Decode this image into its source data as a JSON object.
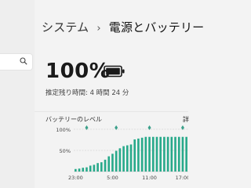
{
  "breadcrumb": {
    "parent": "システム",
    "separator": "›",
    "current": "電源とバッテリー"
  },
  "search": {
    "icon": "search-icon"
  },
  "battery": {
    "percent_label": "100%",
    "level_percent": 100,
    "remaining_label": "推定残り時間: 4 時間 24 分",
    "icon": "battery-full-icon"
  },
  "chart": {
    "title": "バッテリーのレベル",
    "detail_label": "詳",
    "accent_color": "#27a98a",
    "marker_color": "#3aa08a"
  },
  "chart_data": {
    "type": "bar",
    "title": "バッテリーのレベル",
    "xlabel": "",
    "ylabel": "",
    "ylim": [
      0,
      100
    ],
    "y_ticks": [
      "100%",
      "50%"
    ],
    "x_ticks": [
      "23:00",
      "5:00",
      "11:00",
      "17:00"
    ],
    "grid": true,
    "values": [
      6,
      7,
      9,
      10,
      14,
      16,
      20,
      22,
      28,
      36,
      42,
      49,
      55,
      60,
      62,
      64,
      76,
      78,
      80,
      82,
      82,
      82,
      82,
      82,
      82,
      82,
      82,
      82,
      82,
      82,
      82
    ],
    "marker_positions": [
      3,
      11,
      20,
      29
    ]
  }
}
